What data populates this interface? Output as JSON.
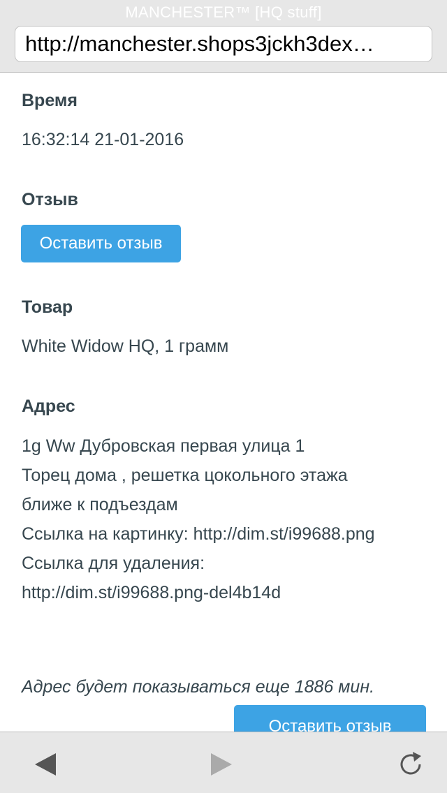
{
  "browser": {
    "page_title": "MANCHESTER™ [HQ stuff]",
    "url": "http://manchester.shops3jckh3dex…"
  },
  "order": {
    "time_label": "Время",
    "time_value": "16:32:14 21-01-2016",
    "review_label": "Отзыв",
    "review_button": "Оставить отзыв",
    "product_label": "Товар",
    "product_value": "White Widow HQ, 1 грамм",
    "address_label": "Адрес",
    "address_lines": [
      "1g Ww Дубровская первая улица 1",
      "Торец дома , решетка цокольного этажа",
      "ближе к подъездам",
      "Ссылка на картинку: http://dim.st/i99688.png",
      "Ссылка для удаления:",
      "http://dim.st/i99688.png-del4b14d"
    ],
    "note": "Адрес будет показываться еще 1886 мин.",
    "bottom_button": "Оставить отзыв"
  },
  "toolbar": {
    "back_icon": "back-arrow-icon",
    "forward_icon": "forward-arrow-icon",
    "reload_icon": "reload-icon"
  },
  "colors": {
    "accent": "#3da3e4",
    "text": "#37474f",
    "chrome": "#e7e7e7"
  }
}
